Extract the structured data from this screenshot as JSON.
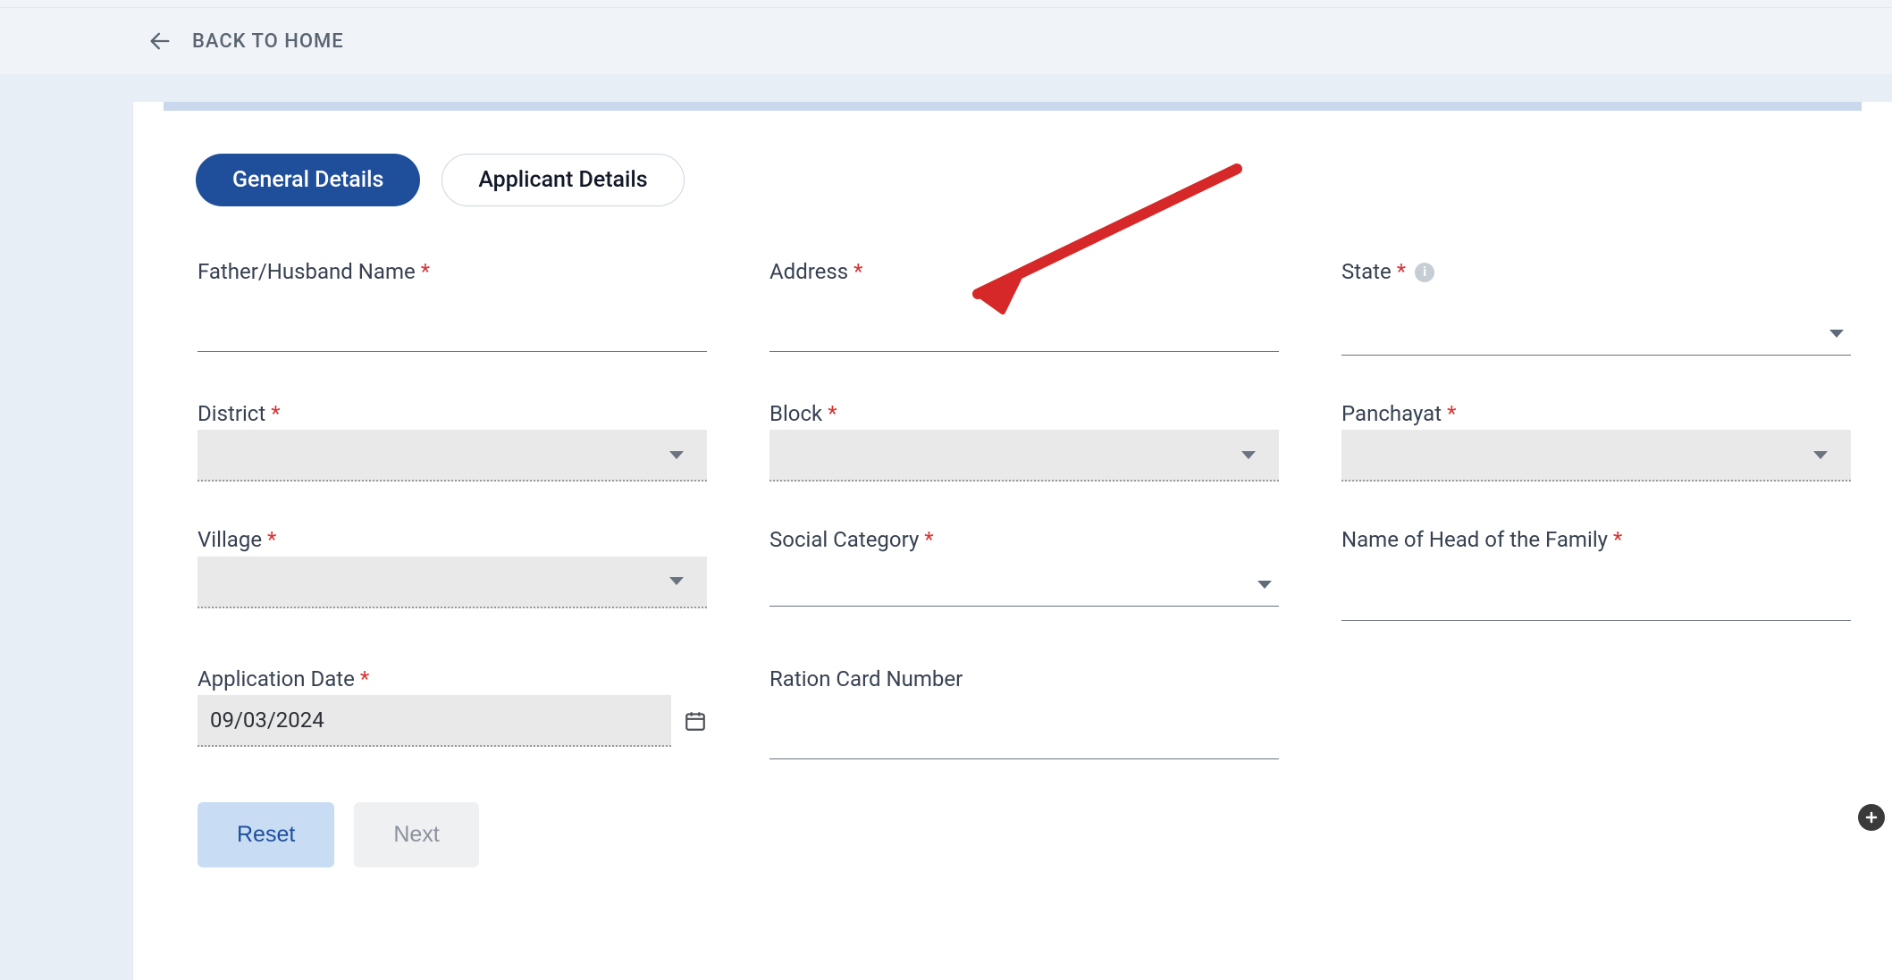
{
  "nav": {
    "back_label": "BACK TO HOME"
  },
  "tabs": {
    "general": "General Details",
    "applicant": "Applicant Details"
  },
  "fields": {
    "father_husband_name": {
      "label": "Father/Husband Name",
      "value": ""
    },
    "address": {
      "label": "Address",
      "value": ""
    },
    "state": {
      "label": "State",
      "value": ""
    },
    "district": {
      "label": "District",
      "value": ""
    },
    "block": {
      "label": "Block",
      "value": ""
    },
    "panchayat": {
      "label": "Panchayat",
      "value": ""
    },
    "village": {
      "label": "Village",
      "value": ""
    },
    "social_category": {
      "label": "Social Category",
      "value": ""
    },
    "head_of_family": {
      "label": "Name of Head of the Family",
      "value": ""
    },
    "application_date": {
      "label": "Application Date",
      "value": "09/03/2024"
    },
    "ration_card": {
      "label": "Ration Card Number",
      "value": ""
    }
  },
  "required_mark": "*",
  "info_glyph": "i",
  "buttons": {
    "reset": "Reset",
    "next": "Next"
  },
  "fab_glyph": "+"
}
